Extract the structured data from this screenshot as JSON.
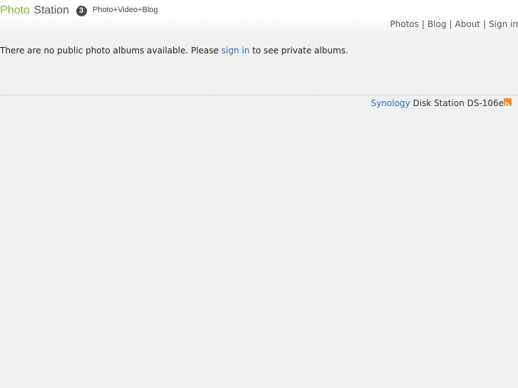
{
  "header": {
    "logo_photo": "Photo",
    "logo_station": "Station",
    "logo_badge": "3",
    "logo_tagline": "Photo+Video+Blog",
    "logo_reflection": "Photo Station"
  },
  "nav": {
    "items": [
      "Photos",
      "Blog",
      "About",
      "Sign in"
    ],
    "separator": "|"
  },
  "message": {
    "before": "There are no public photo albums available. Please ",
    "link": "sign in",
    "after": " to see private albums."
  },
  "footer": {
    "brand_link": "Synology",
    "model": " Disk Station DS-106e",
    "rss_icon": "rss-icon",
    "rss_color": "#f08a24"
  },
  "colors": {
    "logo_green": "#7cb82f",
    "link_blue": "#2a6fb8",
    "background": "#f0f0f0"
  }
}
